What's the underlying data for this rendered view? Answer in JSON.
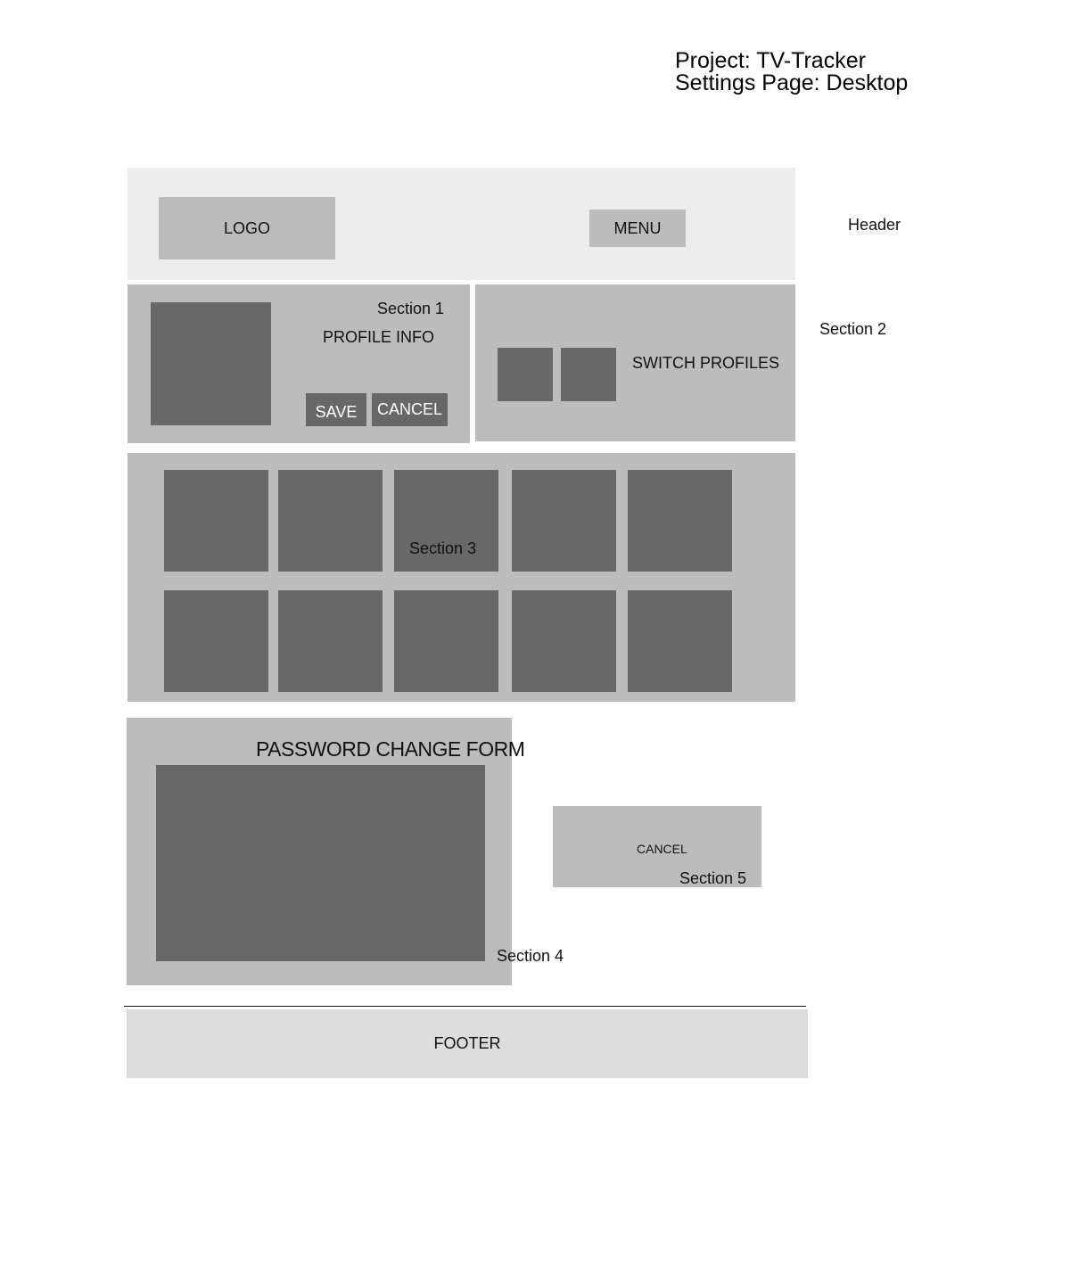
{
  "project": {
    "line1": "Project: TV-Tracker",
    "line2": "Settings Page: Desktop"
  },
  "header": {
    "logo_label": "LOGO",
    "menu_label": "MENU",
    "annotation": "Header"
  },
  "section1": {
    "annotation": "Section 1",
    "title": "PROFILE INFO",
    "save_label": "SAVE",
    "cancel_label": "CANCEL"
  },
  "section2": {
    "annotation": "Section 2",
    "title": "SWITCH PROFILES"
  },
  "section3": {
    "annotation": "Section 3"
  },
  "section4": {
    "title": "PASSWORD CHANGE FORM",
    "annotation": "Section 4"
  },
  "section5": {
    "cancel_label": "CANCEL",
    "annotation": "Section 5"
  },
  "footer": {
    "label": "FOOTER"
  },
  "colors": {
    "header_bg": "#ececec",
    "section_bg": "#bcbcbc",
    "placeholder_dark": "#686868",
    "footer_bg": "#dcdcdc"
  }
}
